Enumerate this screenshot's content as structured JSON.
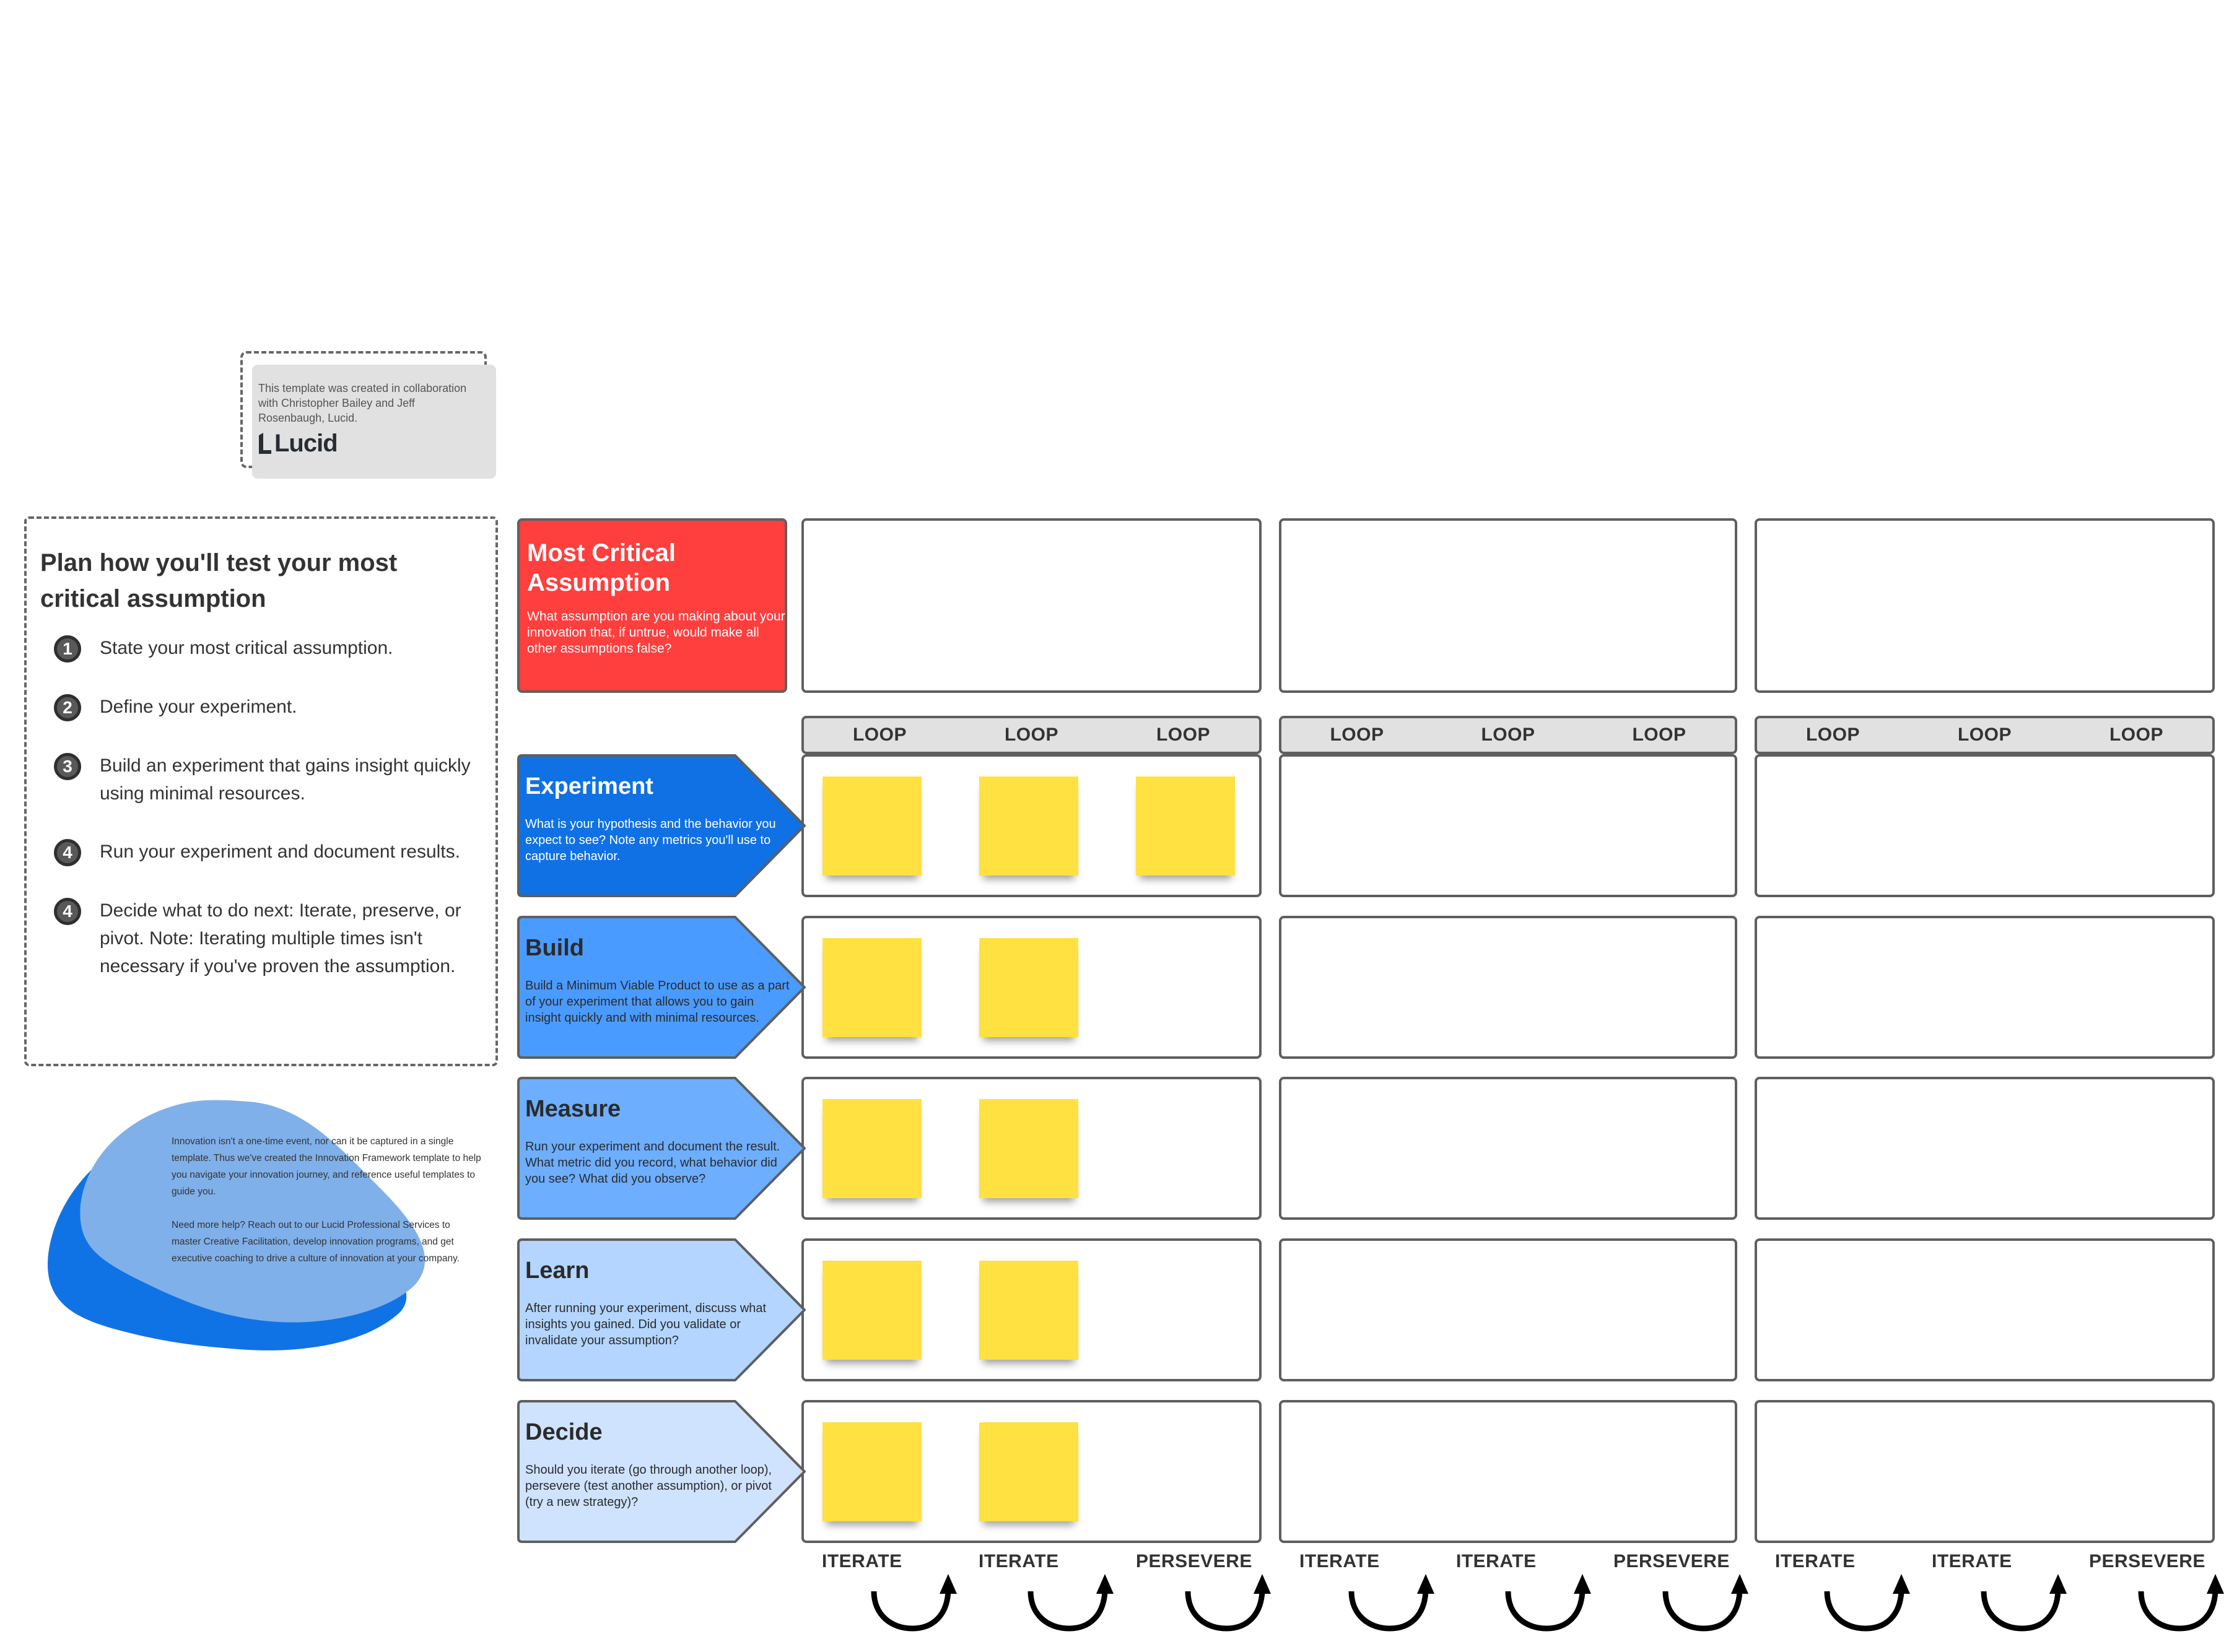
{
  "credit": {
    "text": "This template was created in collaboration with Christopher Bailey and Jeff Rosenbaugh, Lucid.",
    "logo_text": "Lucid"
  },
  "instructions": {
    "title": "Plan how you'll test your most critical assumption",
    "steps": [
      {
        "number": "1",
        "text": "State your most critical assumption."
      },
      {
        "number": "2",
        "text": "Define your experiment."
      },
      {
        "number": "3",
        "text": "Build an experiment that gains insight quickly using minimal resources."
      },
      {
        "number": "4",
        "text": "Run your experiment and document results."
      },
      {
        "number": "4",
        "text": "Decide what to do next: Iterate, preserve, or pivot. Note: Iterating multiple times isn't necessary if you've proven the assumption."
      }
    ]
  },
  "info_blob": {
    "paragraph1": "Innovation isn't a one-time event, nor can it be captured in a single template. Thus we've created the Innovation Framework template to help you navigate your innovation journey, and reference useful templates to guide you.",
    "paragraph2": "Need more help? Reach out to our Lucid Professional Services to master Creative Facilitation, develop innovation programs, and get executive coaching to drive a culture of innovation at your company."
  },
  "critical_assumption": {
    "title": "Most Critical Assumption",
    "description": "What assumption are you making about your innovation that, if untrue, would make all other assumptions false?",
    "color": "#ff3e3e"
  },
  "loop_label": "LOOP",
  "columns": [
    {
      "loops": [
        "LOOP",
        "LOOP",
        "LOOP"
      ],
      "outcomes": [
        "ITERATE",
        "ITERATE",
        "PERSEVERE"
      ]
    },
    {
      "loops": [
        "LOOP",
        "LOOP",
        "LOOP"
      ],
      "outcomes": [
        "ITERATE",
        "ITERATE",
        "PERSEVERE"
      ]
    },
    {
      "loops": [
        "LOOP",
        "LOOP",
        "LOOP"
      ],
      "outcomes": [
        "ITERATE",
        "ITERATE",
        "PERSEVERE"
      ]
    }
  ],
  "stages": [
    {
      "title": "Experiment",
      "description": "What is your hypothesis and the behavior you expect to see? Note any metrics you'll use to capture behavior.",
      "color": "#1071e5",
      "text_color": "#ffffff",
      "stickies_in_first_column": 3
    },
    {
      "title": "Build",
      "description": "Build a Minimum Viable Product to use as a part of your experiment that allows you to gain insight quickly and with minimal resources.",
      "color": "#4a9bff",
      "text_color": "#2b2b2b",
      "stickies_in_first_column": 2
    },
    {
      "title": "Measure",
      "description": "Run your experiment and document the result. What metric did you record, what behavior did you see? What did you observe?",
      "color": "#6daeff",
      "text_color": "#2b2b2b",
      "stickies_in_first_column": 2
    },
    {
      "title": "Learn",
      "description": "After running your experiment, discuss what insights you gained. Did you validate or invalidate your assumption?",
      "color": "#b3d5ff",
      "text_color": "#2b2b2b",
      "stickies_in_first_column": 2
    },
    {
      "title": "Decide",
      "description": "Should you iterate (go through another loop), persevere (test another assumption), or pivot (try a new strategy)?",
      "color": "#cfe3ff",
      "text_color": "#2b2b2b",
      "stickies_in_first_column": 2
    }
  ],
  "colors": {
    "sticky": "#ffe142",
    "blob_dark": "#0f73e6",
    "blob_light": "#80b0ea",
    "loop_header_bg": "#e1e1e1"
  }
}
